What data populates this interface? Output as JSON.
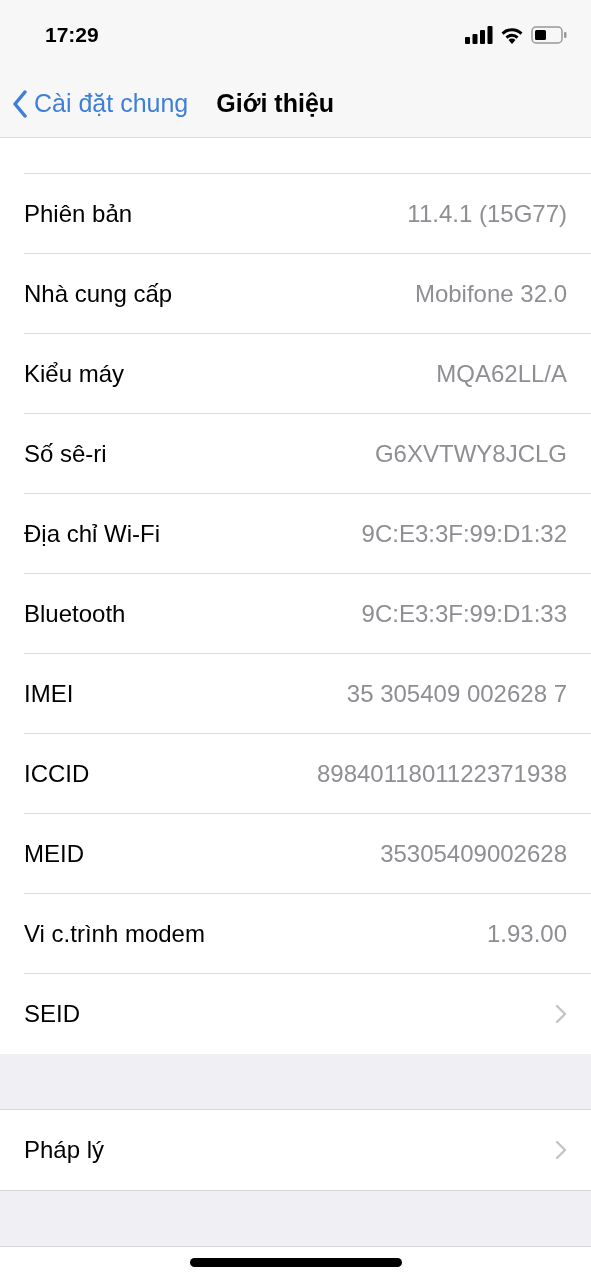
{
  "status_bar": {
    "time": "17:29"
  },
  "nav": {
    "back": "Cài đặt chung",
    "title": "Giới thiệu"
  },
  "rows": [
    {
      "label": "Phiên bản",
      "value": "11.4.1 (15G77)",
      "kind": "value"
    },
    {
      "label": "Nhà cung cấp",
      "value": "Mobifone 32.0",
      "kind": "value"
    },
    {
      "label": "Kiểu máy",
      "value": "MQA62LL/A",
      "kind": "value"
    },
    {
      "label": "Số sê-ri",
      "value": "G6XVTWY8JCLG",
      "kind": "value"
    },
    {
      "label": "Địa chỉ Wi-Fi",
      "value": "9C:E3:3F:99:D1:32",
      "kind": "value"
    },
    {
      "label": "Bluetooth",
      "value": "9C:E3:3F:99:D1:33",
      "kind": "value"
    },
    {
      "label": "IMEI",
      "value": "35 305409 002628 7",
      "kind": "value"
    },
    {
      "label": "ICCID",
      "value": "8984011801122371938",
      "kind": "value"
    },
    {
      "label": "MEID",
      "value": "35305409002628",
      "kind": "value"
    },
    {
      "label": "Vi c.trình modem",
      "value": "1.93.00",
      "kind": "value"
    },
    {
      "label": "SEID",
      "kind": "link"
    }
  ],
  "legal_rows": [
    {
      "label": "Pháp lý",
      "kind": "link"
    }
  ]
}
